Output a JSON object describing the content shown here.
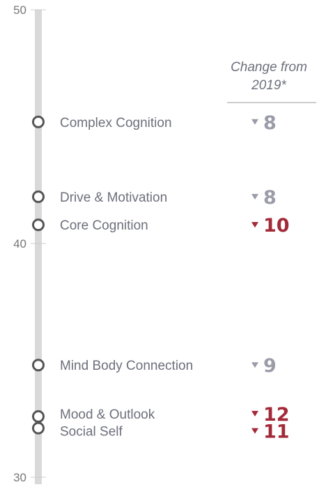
{
  "chart_data": {
    "type": "scatter",
    "orientation": "vertical-strip",
    "ylim": [
      30,
      50
    ],
    "yticks": [
      30,
      40,
      50
    ],
    "yticks_labels": [
      "30",
      "40",
      "50"
    ],
    "column_header": [
      "Change from",
      "2019*"
    ],
    "series": [
      {
        "name": "Complex Cognition",
        "value": 45.2,
        "change": "8",
        "direction": "down",
        "highlight": false
      },
      {
        "name": "Drive & Motivation",
        "value": 42.0,
        "change": "8",
        "direction": "down",
        "highlight": false
      },
      {
        "name": "Core Cognition",
        "value": 40.8,
        "change": "10",
        "direction": "down",
        "highlight": true
      },
      {
        "name": "Mind Body Connection",
        "value": 34.8,
        "change": "9",
        "direction": "down",
        "highlight": false
      },
      {
        "name": "Mood & Outlook",
        "value": 32.6,
        "change": "12",
        "direction": "down",
        "highlight": true
      },
      {
        "name": "Social Self",
        "value": 32.1,
        "change": "11",
        "direction": "down",
        "highlight": true
      }
    ]
  },
  "colors": {
    "axis": "#d9d9d9",
    "tick": "#cccccc",
    "marker": "#555555",
    "change_neutral": "#9a9ca8",
    "change_highlight": "#a32a38",
    "header_rule": "#999999"
  }
}
